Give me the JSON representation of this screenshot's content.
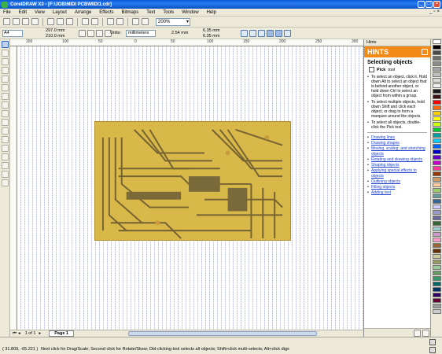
{
  "window": {
    "title": "CorelDRAW X3 - [F:\\JOB\\MIDI PCB\\MIDI1.cdr]"
  },
  "menu": [
    "File",
    "Edit",
    "View",
    "Layout",
    "Arrange",
    "Effects",
    "Bitmaps",
    "Text",
    "Tools",
    "Window",
    "Help"
  ],
  "toolbar": {
    "zoom": "200%"
  },
  "propbar": {
    "paper": "A4",
    "width": "297.0 mm",
    "height": "210.0 mm",
    "units_label": "Units:",
    "units_value": "millimeters",
    "nudge": "2.54 mm",
    "dup_x": "6.35 mm",
    "dup_y": "6.35 mm"
  },
  "ruler": {
    "ticks": [
      "150",
      "100",
      "50",
      "0",
      "50",
      "100",
      "150",
      "200",
      "250",
      "300"
    ]
  },
  "hints": {
    "dock_title": "Hints",
    "banner": "HINTS",
    "heading": "Selecting objects",
    "tool_name": "Pick",
    "tool_suffix": "tool",
    "bullets": [
      "To select an object, click it. Hold down Alt to select an object that is behind another object, or hold down Ctrl to select an object from within a group.",
      "To select multiple objects, hold down Shift and click each object, or drag to form a marquee around the objects.",
      "To select all objects, double-click the Pick tool."
    ],
    "links": [
      "Drawing lines",
      "Drawing shapes",
      "Moving, scaling, and stretching objects",
      "Rotating and skewing objects",
      "Shaping objects",
      "Applying special effects to objects",
      "Outlining objects",
      "Filling objects",
      "Adding text"
    ]
  },
  "pages": {
    "position": "1 of 1",
    "tab": "Page 1"
  },
  "status": {
    "coords": "( 31.809, -65.221 )",
    "message": "Next click for Drag/Scale; Second click for Rotate/Skew; Dbl-clicking tool selects all objects; Shift+click multi-selects; Alt+click digs"
  },
  "palette": [
    "#ffffff",
    "#000000",
    "#4a4a4a",
    "#6e6e6e",
    "#8c8c8c",
    "#a5a5a5",
    "#c0c0c0",
    "#d9d9d9",
    "#f0f0f0",
    "#1a1a1a",
    "#3a1010",
    "#ff0000",
    "#ff6600",
    "#ffcc00",
    "#ffff00",
    "#ccff00",
    "#00cc33",
    "#00a0a0",
    "#00ccff",
    "#0066ff",
    "#0000cc",
    "#6600cc",
    "#cc00cc",
    "#ff3399",
    "#993300",
    "#cc9966",
    "#ffcc99",
    "#99cc66",
    "#669999",
    "#336699",
    "#ccccff",
    "#9999cc",
    "#666699",
    "#336633",
    "#99cccc",
    "#cc99cc",
    "#ff99cc",
    "#996633",
    "#663300",
    "#cccc99",
    "#999966",
    "#99cc99",
    "#669966",
    "#339966",
    "#006666",
    "#003366",
    "#330066",
    "#660033",
    "#999999",
    "#cccccc"
  ]
}
